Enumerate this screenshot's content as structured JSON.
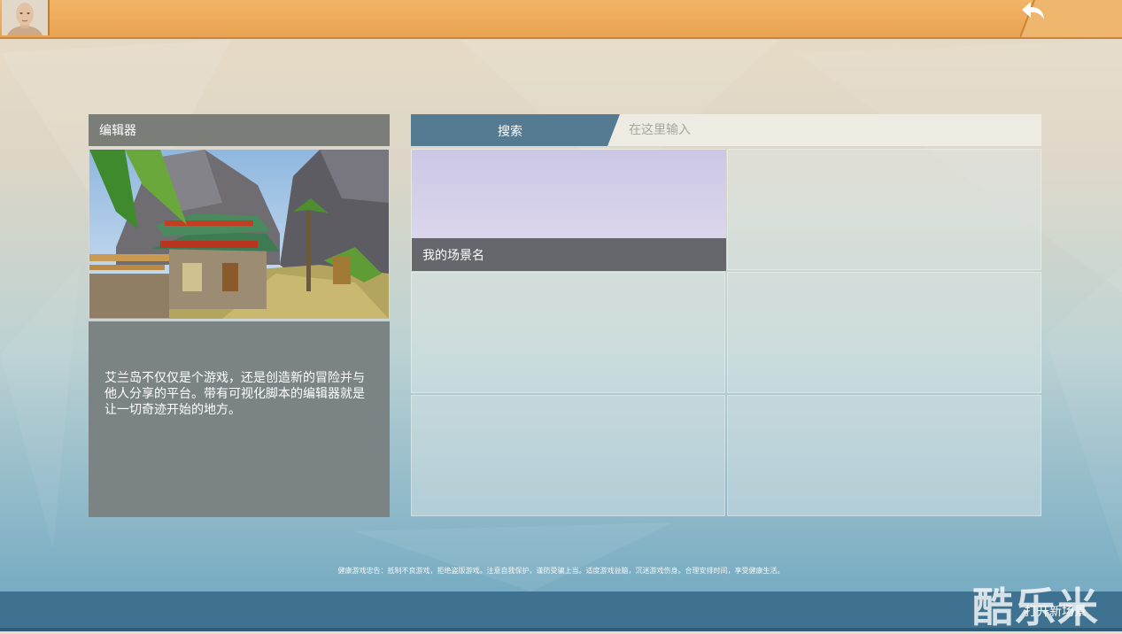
{
  "editor": {
    "title": "编辑器",
    "description": "艾兰岛不仅仅是个游戏，还是创造新的冒险并与他人分享的平台。带有可视化脚本的编辑器就是让一切奇迹开始的地方。"
  },
  "search": {
    "label": "搜索",
    "placeholder": "在这里输入",
    "value": ""
  },
  "scenes": [
    {
      "name": "我的场景名"
    }
  ],
  "footer": {
    "notice": "健康游戏忠告：抵制不良游戏，拒绝盗版游戏。注意自我保护，谨防受骗上当。适度游戏益脑，沉迷游戏伤身。合理安排时间，享受健康生活。",
    "open_new_scene": "打开新场景"
  },
  "watermark": "酷乐米",
  "icons": {
    "avatar": "avatar-icon",
    "back": "back-arrow-icon"
  },
  "colors": {
    "topbar": "#eda856",
    "search_tab": "#557b92",
    "bottombar": "#3f7290"
  }
}
